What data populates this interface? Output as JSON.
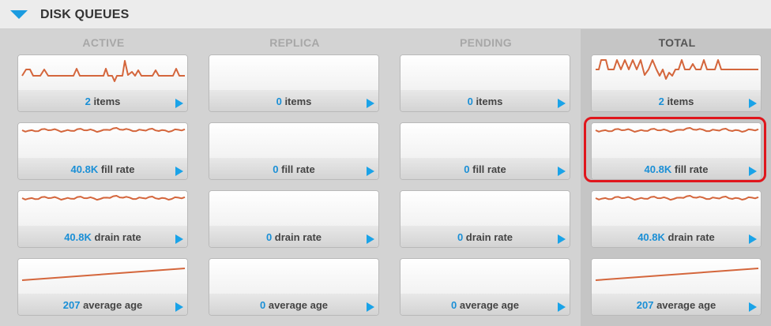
{
  "header": {
    "title": "DISK QUEUES"
  },
  "columns": [
    {
      "name": "ACTIVE",
      "cards": [
        {
          "value": "2",
          "unit": "items",
          "trend": "spiky"
        },
        {
          "value": "40.8K",
          "unit": "fill rate",
          "trend": "noisy"
        },
        {
          "value": "40.8K",
          "unit": "drain rate",
          "trend": "noisy"
        },
        {
          "value": "207",
          "unit": "average age",
          "trend": "rising"
        }
      ]
    },
    {
      "name": "REPLICA",
      "cards": [
        {
          "value": "0",
          "unit": "items",
          "trend": "flat"
        },
        {
          "value": "0",
          "unit": "fill rate",
          "trend": "flat"
        },
        {
          "value": "0",
          "unit": "drain rate",
          "trend": "flat"
        },
        {
          "value": "0",
          "unit": "average age",
          "trend": "flat"
        }
      ]
    },
    {
      "name": "PENDING",
      "cards": [
        {
          "value": "0",
          "unit": "items",
          "trend": "flat"
        },
        {
          "value": "0",
          "unit": "fill rate",
          "trend": "flat"
        },
        {
          "value": "0",
          "unit": "drain rate",
          "trend": "flat"
        },
        {
          "value": "0",
          "unit": "average age",
          "trend": "flat"
        }
      ]
    },
    {
      "name": "TOTAL",
      "cards": [
        {
          "value": "2",
          "unit": "items",
          "trend": "spiky2"
        },
        {
          "value": "40.8K",
          "unit": "fill rate",
          "trend": "noisy"
        },
        {
          "value": "40.8K",
          "unit": "drain rate",
          "trend": "noisy"
        },
        {
          "value": "207",
          "unit": "average age",
          "trend": "rising"
        }
      ]
    }
  ],
  "icons": {
    "toggle": "triangle-down-icon",
    "open": "play-arrow-icon"
  },
  "colors": {
    "accent": "#1a9be0",
    "sparkline": "#d4663c",
    "highlight": "#e0161c"
  },
  "highlighted": {
    "column": 3,
    "row": 1
  }
}
